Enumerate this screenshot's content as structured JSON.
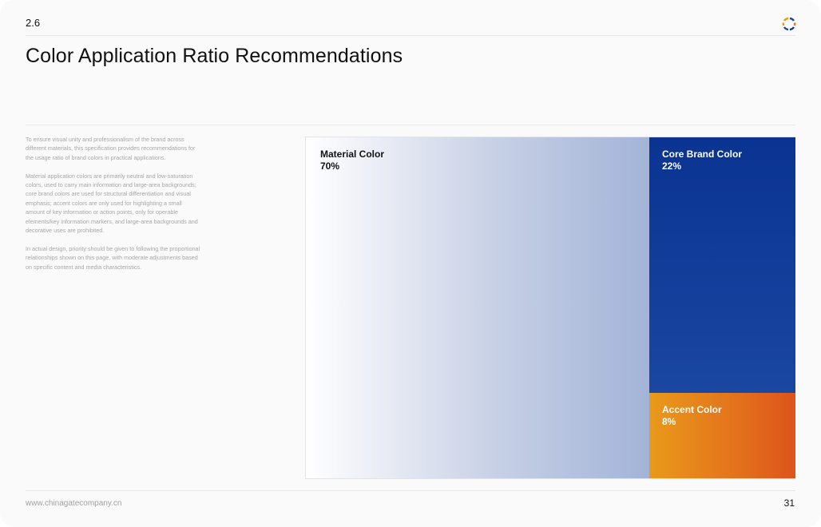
{
  "header": {
    "section_number": "2.6",
    "logo_icon": "ring-logo-icon"
  },
  "title": "Color Application Ratio Recommendations",
  "description": {
    "paragraphs": [
      "To ensure visual unity and professionalism of the brand across different materials, this specification provides recommendations for the usage ratio of brand colors in practical applications.",
      "Material application colors are primarily neutral and low-saturation colors, used to carry main information and large-area backgrounds; core brand colors are used for structural differentiation and visual emphasis; accent colors are only used for highlighting a small amount of key information or action points, only for operable elements/key information markers, and large-area backgrounds and decorative uses are prohibited.",
      "In actual design, priority should be given to following the proportional relationships shown on this page, with moderate adjustments based on specific content and media characteristics."
    ]
  },
  "ratio_blocks": {
    "material": {
      "label": "Material Color",
      "percent": "70%"
    },
    "core_brand": {
      "label": "Core Brand Color",
      "percent": "22%"
    },
    "accent": {
      "label": "Accent Color",
      "percent": "8%"
    }
  },
  "colors": {
    "core_brand": "#0a3392",
    "accent": "#e4751c",
    "material_end": "#a3b4d8"
  },
  "footer": {
    "url": "www.chinagatecompany.cn",
    "page_number": "31"
  }
}
